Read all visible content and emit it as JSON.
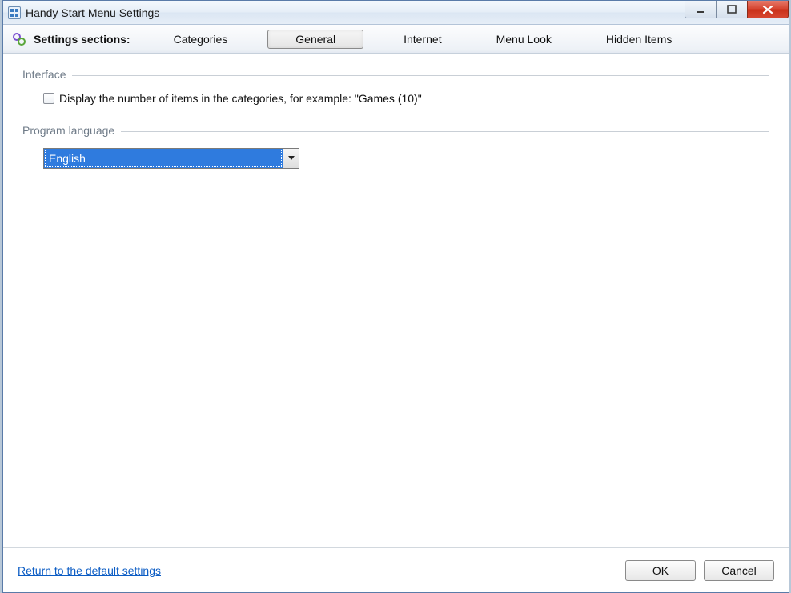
{
  "title": "Handy Start Menu Settings",
  "toolbar": {
    "label": "Settings sections:",
    "tabs": {
      "categories": "Categories",
      "general": "General",
      "internet": "Internet",
      "menu_look": "Menu Look",
      "hidden_items": "Hidden Items"
    },
    "active_tab": "general"
  },
  "groups": {
    "interface": {
      "legend": "Interface",
      "display_count_label": "Display the number of items in the categories, for example: \"Games (10)\"",
      "display_count_checked": false
    },
    "language": {
      "legend": "Program language",
      "selected": "English"
    }
  },
  "footer": {
    "reset_link": "Return to the default settings",
    "ok": "OK",
    "cancel": "Cancel"
  }
}
